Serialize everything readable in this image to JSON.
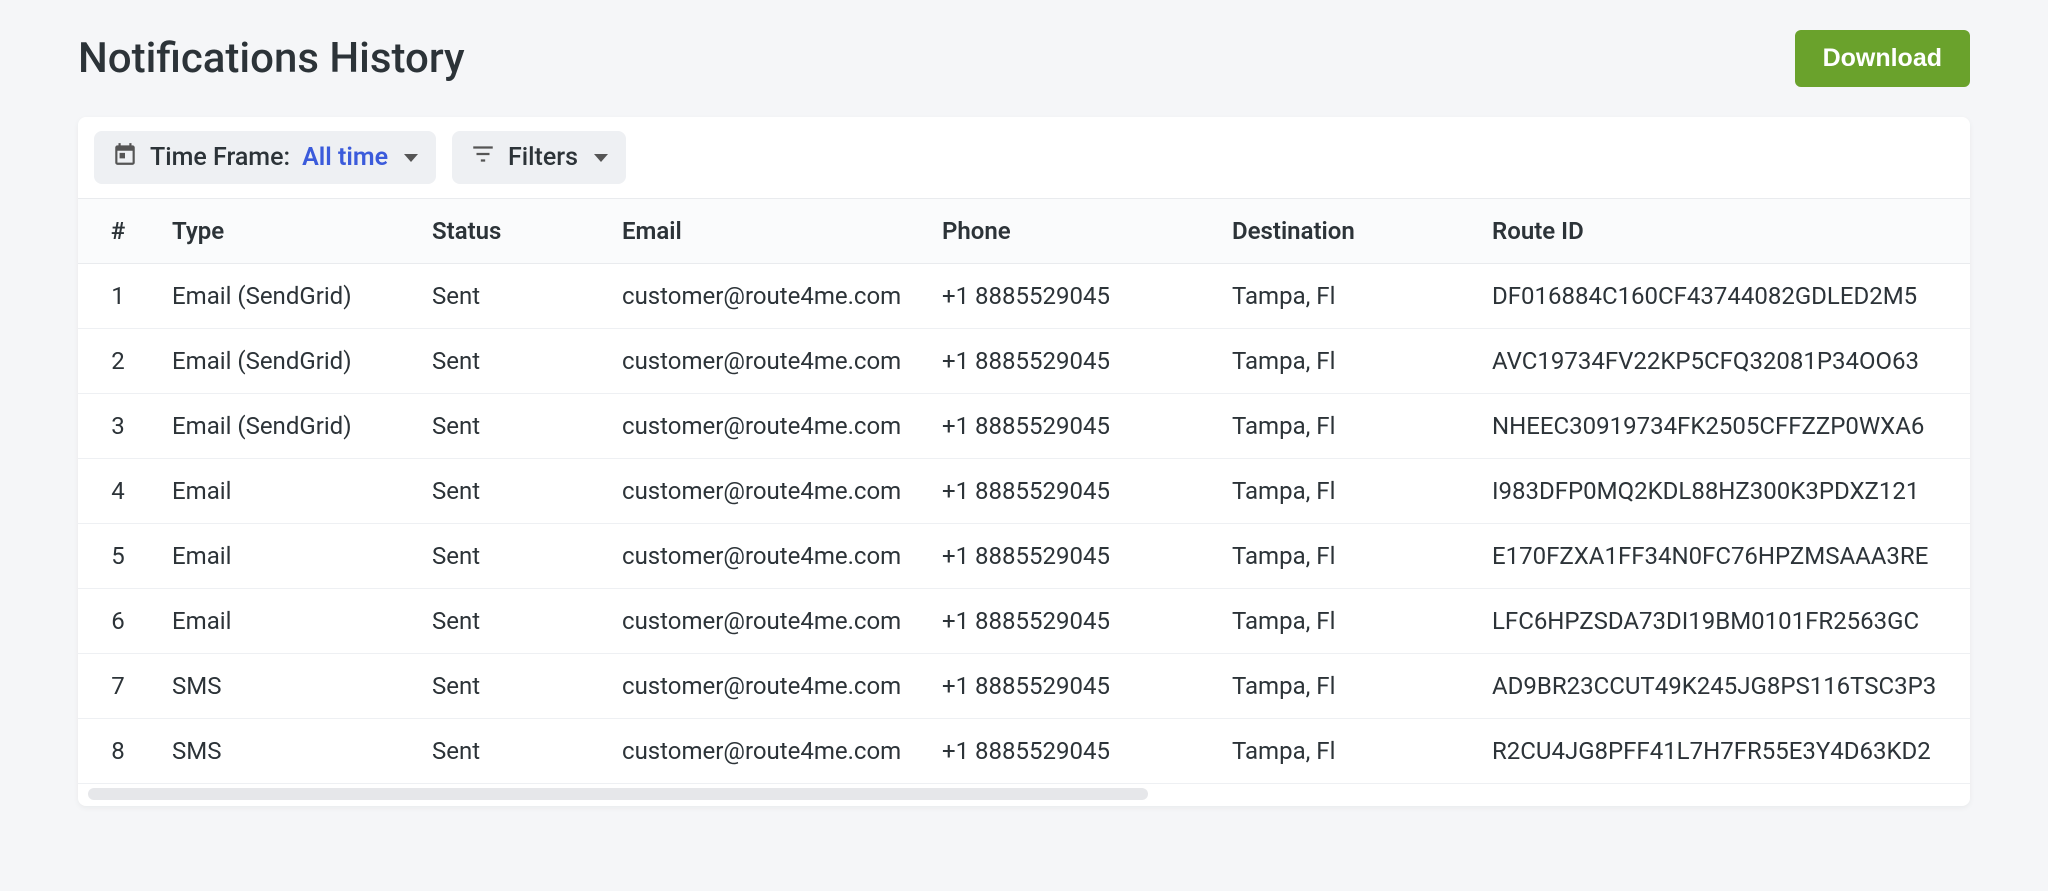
{
  "header": {
    "title": "Notifications History",
    "download_label": "Download"
  },
  "toolbar": {
    "timeframe_label": "Time Frame:",
    "timeframe_value": "All time",
    "filters_label": "Filters"
  },
  "table": {
    "headers": {
      "num": "#",
      "type": "Type",
      "status": "Status",
      "email": "Email",
      "phone": "Phone",
      "destination": "Destination",
      "route_id": "Route ID"
    },
    "rows": [
      {
        "num": "1",
        "type": "Email (SendGrid)",
        "status": "Sent",
        "email": "customer@route4me.com",
        "phone": "+1 8885529045",
        "destination": "Tampa, Fl",
        "route_id": "DF016884C160CF43744082GDLED2M5"
      },
      {
        "num": "2",
        "type": "Email (SendGrid)",
        "status": "Sent",
        "email": "customer@route4me.com",
        "phone": "+1 8885529045",
        "destination": "Tampa, Fl",
        "route_id": "AVC19734FV22KP5CFQ32081P34OO63"
      },
      {
        "num": "3",
        "type": "Email (SendGrid)",
        "status": "Sent",
        "email": "customer@route4me.com",
        "phone": "+1 8885529045",
        "destination": "Tampa, Fl",
        "route_id": "NHEEC30919734FK2505CFFZZP0WXA6"
      },
      {
        "num": "4",
        "type": "Email",
        "status": "Sent",
        "email": "customer@route4me.com",
        "phone": "+1 8885529045",
        "destination": "Tampa, Fl",
        "route_id": "I983DFP0MQ2KDL88HZ300K3PDXZ121"
      },
      {
        "num": "5",
        "type": "Email",
        "status": "Sent",
        "email": "customer@route4me.com",
        "phone": "+1 8885529045",
        "destination": "Tampa, Fl",
        "route_id": "E170FZXA1FF34N0FC76HPZMSAAA3RE"
      },
      {
        "num": "6",
        "type": "Email",
        "status": "Sent",
        "email": "customer@route4me.com",
        "phone": "+1 8885529045",
        "destination": "Tampa, Fl",
        "route_id": "LFC6HPZSDA73DI19BM0101FR2563GC"
      },
      {
        "num": "7",
        "type": "SMS",
        "status": "Sent",
        "email": "customer@route4me.com",
        "phone": "+1 8885529045",
        "destination": "Tampa, Fl",
        "route_id": "AD9BR23CCUT49K245JG8PS116TSC3P3"
      },
      {
        "num": "8",
        "type": "SMS",
        "status": "Sent",
        "email": "customer@route4me.com",
        "phone": "+1 8885529045",
        "destination": "Tampa, Fl",
        "route_id": "R2CU4JG8PFF41L7H7FR55E3Y4D63KD2"
      }
    ]
  }
}
